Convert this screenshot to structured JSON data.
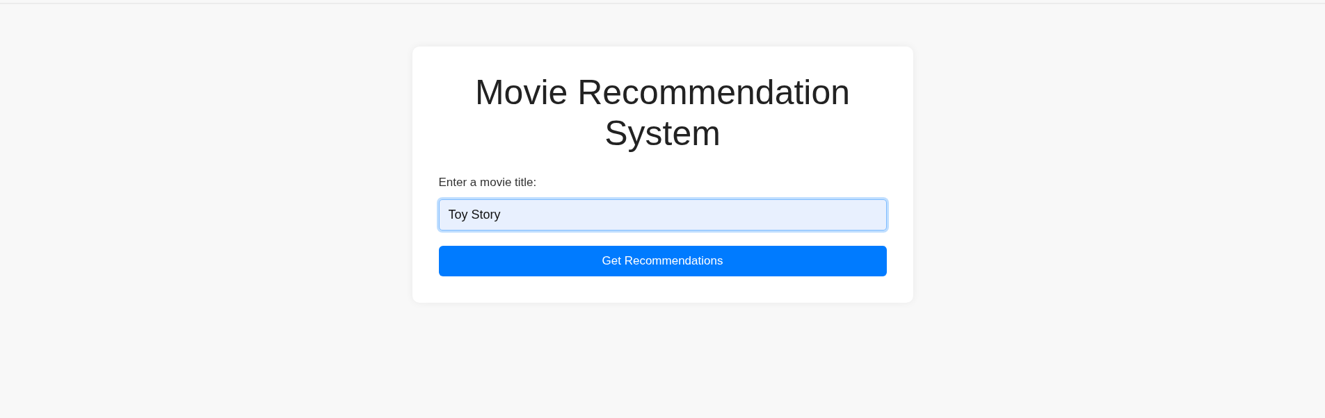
{
  "card": {
    "title": "Movie Recommendation System",
    "form": {
      "label": "Enter a movie title:",
      "input": {
        "value": "Toy Story",
        "focused": true
      },
      "button": "Get Recommendations"
    }
  }
}
